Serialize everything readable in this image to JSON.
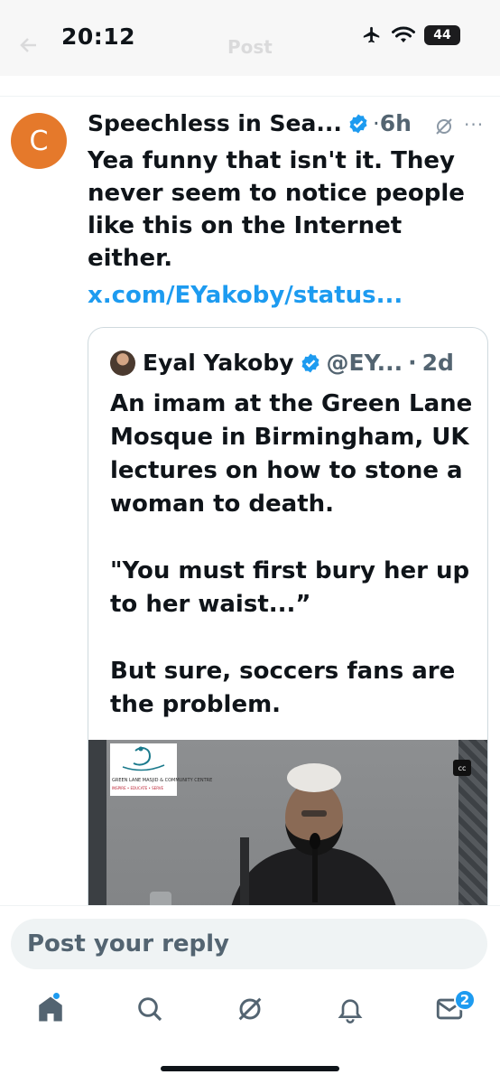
{
  "status_bar": {
    "time": "20:12",
    "battery": "44"
  },
  "header": {
    "title": "Post"
  },
  "post": {
    "avatar_letter": "C",
    "avatar_color": "#e5792b",
    "author": "Speechless in Sea...",
    "separator": "·",
    "time": "6h",
    "text": "Yea funny that isn't it.  They\nnever seem to notice people\nlike this on the Internet either.",
    "link": "x.com/EYakoby/status..."
  },
  "quote": {
    "author": "Eyal Yakoby",
    "handle": "@EY...",
    "separator": "·",
    "time": "2d",
    "text": "An imam at the Green Lane\nMosque in Birmingham, UK\nlectures on how to stone a\nwoman to death.\n\n\"You must first bury her up\nto her waist...”\n\nBut sure, soccers fans are\nthe problem.",
    "media": {
      "logo_text": "GREEN LANE MASJID & COMMUNITY CENTRE",
      "logo_sub": "INSPIRE • EDUCATE • SERVE",
      "cc_label": "cc"
    }
  },
  "reply": {
    "placeholder": "Post your reply"
  },
  "nav": {
    "items": [
      "home-icon",
      "search-icon",
      "grok-icon",
      "notifications-icon",
      "messages-icon"
    ],
    "messages_badge": "2"
  },
  "colors": {
    "accent": "#1d9bf0",
    "text": "#0f1419",
    "muted": "#536471"
  }
}
